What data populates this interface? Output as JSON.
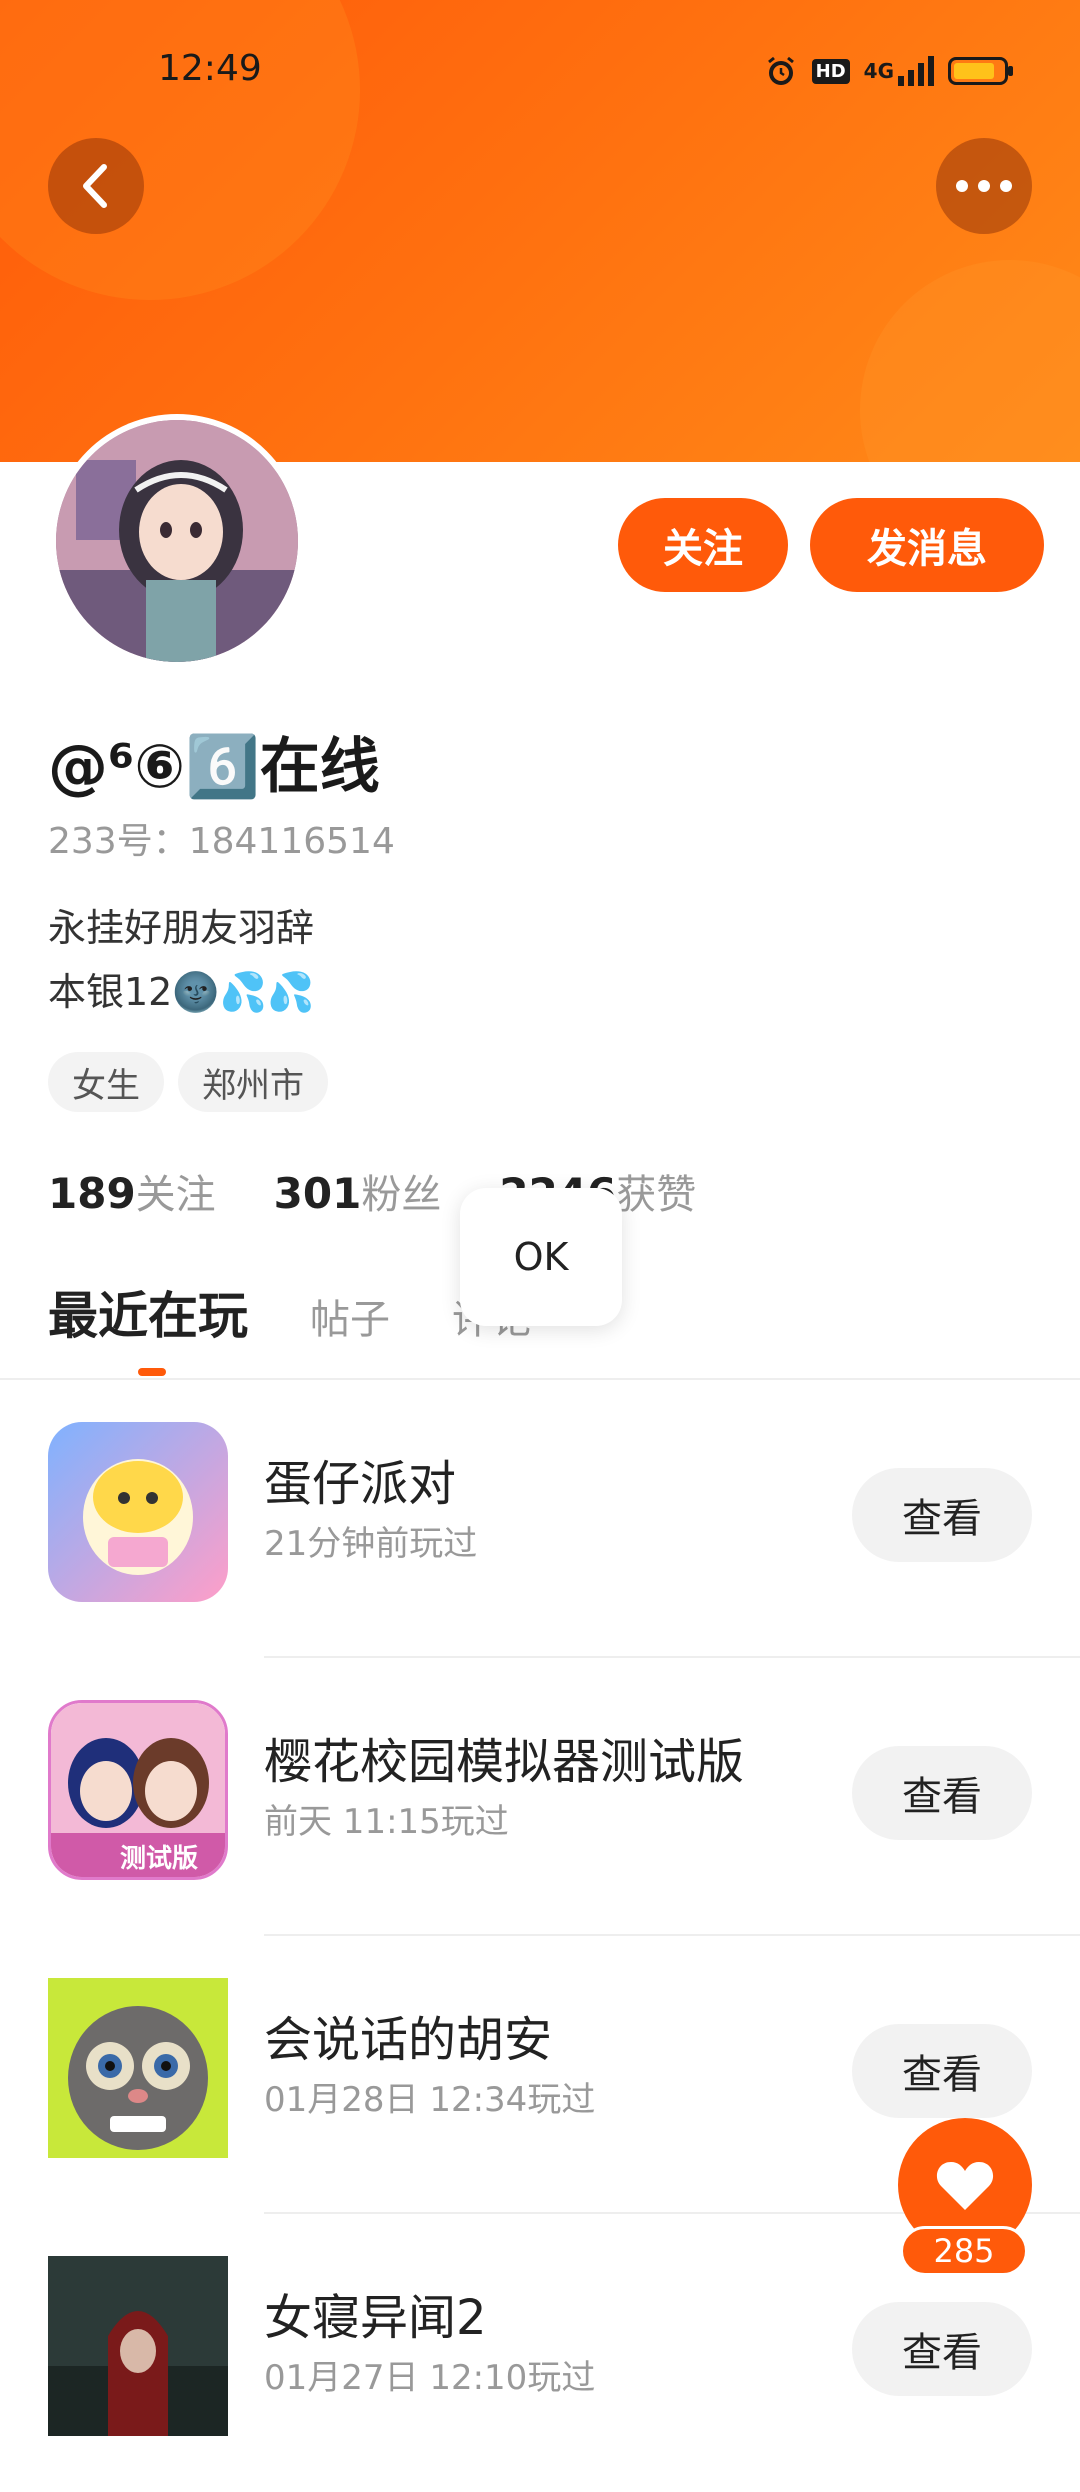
{
  "status_bar": {
    "time": "12:49",
    "hd": "HD",
    "network": "4G",
    "icons": [
      "alarm-icon",
      "hd-icon",
      "signal-icon",
      "battery-icon"
    ],
    "battery_color": "#ffc21a"
  },
  "header": {
    "gradient_start": "#ff5a0a",
    "gradient_end": "#ff8a18",
    "back_icon": "chevron-left-icon",
    "more_icon": "more-dots-icon"
  },
  "actions": {
    "follow_label": "关注",
    "message_label": "发消息",
    "accent": "#ff5a0a"
  },
  "profile": {
    "username": "@⁶⑥6️⃣在线",
    "id_text": "233号：184116514",
    "bio_line1": "永挂好朋友羽辞",
    "bio_line2": "本银12🌚💦💦",
    "tags": [
      "女生",
      "郑州市"
    ]
  },
  "stats": {
    "following_num": "189",
    "following_label": "关注",
    "fans_num": "301",
    "fans_label": "粉丝",
    "likes_num": "2246",
    "likes_label": "获赞"
  },
  "toast": {
    "text": "OK"
  },
  "tabs": {
    "recent": "最近在玩",
    "posts": "帖子",
    "comments": "评论"
  },
  "games": [
    {
      "title": "蛋仔派对",
      "subtitle": "21分钟前玩过",
      "button": "查看"
    },
    {
      "title": "樱花校园模拟器测试版",
      "subtitle": "前天 11:15玩过",
      "button": "查看",
      "icon_badge": "测试版"
    },
    {
      "title": "会说话的胡安",
      "subtitle": "01月28日 12:34玩过",
      "button": "查看"
    },
    {
      "title": "女寝异闻2",
      "subtitle": "01月27日 12:10玩过",
      "button": "查看"
    }
  ],
  "like": {
    "count": "285",
    "icon": "heart-icon"
  }
}
